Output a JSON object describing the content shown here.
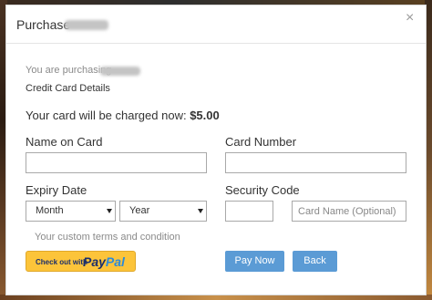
{
  "modal": {
    "title": "Purchase",
    "close_glyph": "×"
  },
  "info": {
    "purchasing_label": "You are purchasing",
    "section_title": "Credit Card Details",
    "charged_prefix": "Your card will be charged now:",
    "amount": "$5.00"
  },
  "form": {
    "name_label": "Name on Card",
    "name_value": "",
    "card_number_label": "Card Number",
    "card_number_value": "",
    "expiry_label": "Expiry Date",
    "month_selected": "Month",
    "year_selected": "Year",
    "security_label": "Security Code",
    "security_value": "",
    "card_name_placeholder": "Card Name (Optional)"
  },
  "terms_text": "Your custom terms and condition",
  "paypal": {
    "prefix": "Check out with",
    "logo_pay": "Pay",
    "logo_pal": "Pal"
  },
  "buttons": {
    "pay_now": "Pay Now",
    "back": "Back"
  },
  "colors": {
    "button_blue": "#5b9bd5",
    "paypal_yellow": "#fcc43a"
  }
}
